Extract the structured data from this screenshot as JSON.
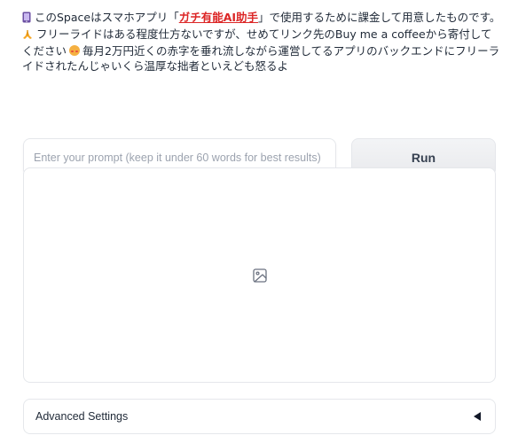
{
  "notice": {
    "line1_icon": "smartphone-icon",
    "line1_prefix": "このSpaceはスマホアプリ「",
    "line1_link": "ガチ有能AI助手",
    "line1_suffix": "」で使用するために課金して用意したものです。",
    "line2_icon": "pray-icon",
    "line2_part1": "フリーライドはある程度仕方ないですが、せめてリンク先のBuy me a coffeeから寄付してください",
    "line2_emoji": "blush-emoji-icon",
    "line2_part2": "毎月2万円近くの赤字を垂れ流しながら運営してるアプリのバックエンドにフリーライドされたんじゃいくら温厚な拙者といえども怒るよ"
  },
  "prompt": {
    "placeholder": "Enter your prompt (keep it under 60 words for best results)",
    "value": ""
  },
  "run_button": {
    "label": "Run"
  },
  "output": {
    "placeholder_icon": "image-placeholder-icon"
  },
  "advanced": {
    "label": "Advanced Settings",
    "icon": "caret-left-icon"
  },
  "colors": {
    "link": "#dc2626",
    "border": "#e5e7eb",
    "button_bg": "#f3f4f6",
    "placeholder_text": "#9ca3af"
  }
}
